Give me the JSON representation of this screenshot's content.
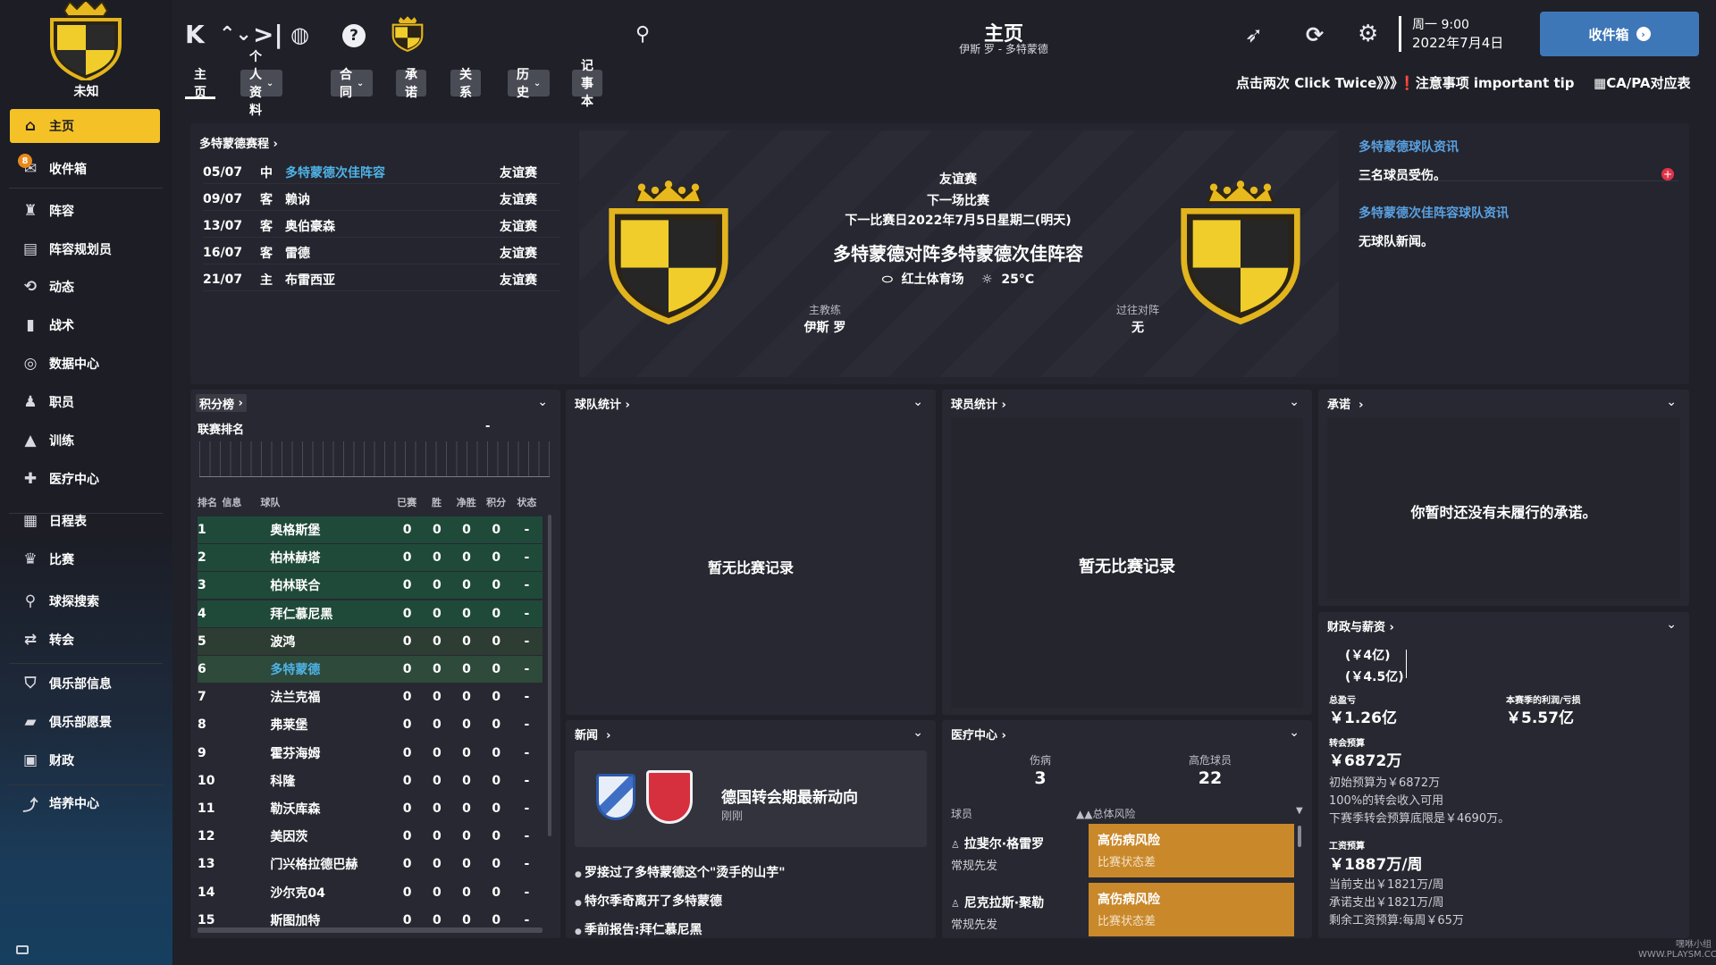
{
  "club": {
    "name": "未知"
  },
  "sidebar": {
    "items": [
      {
        "label": "主页",
        "icon": "home-icon"
      },
      {
        "label": "收件箱",
        "icon": "inbox-icon",
        "badge": "8"
      },
      {
        "label": "阵容",
        "icon": "shirt-icon"
      },
      {
        "label": "阵容规划员",
        "icon": "clipboard-icon"
      },
      {
        "label": "动态",
        "icon": "dynamics-icon"
      },
      {
        "label": "战术",
        "icon": "tactics-icon"
      },
      {
        "label": "数据中心",
        "icon": "data-icon"
      },
      {
        "label": "职员",
        "icon": "staff-icon"
      },
      {
        "label": "训练",
        "icon": "training-icon"
      },
      {
        "label": "医疗中心",
        "icon": "medical-icon"
      },
      {
        "label": "日程表",
        "icon": "calendar-icon"
      },
      {
        "label": "比赛",
        "icon": "trophy-icon"
      },
      {
        "label": "球探搜索",
        "icon": "search-icon"
      },
      {
        "label": "转会",
        "icon": "transfer-icon"
      },
      {
        "label": "俱乐部信息",
        "icon": "shield-icon"
      },
      {
        "label": "俱乐部愿景",
        "icon": "vision-icon"
      },
      {
        "label": "财政",
        "icon": "finance-icon"
      },
      {
        "label": "培养中心",
        "icon": "development-icon"
      }
    ]
  },
  "header": {
    "title": "主页",
    "subtitle": "伊斯 罗 - 多特蒙德",
    "time": "周一 9:00",
    "date": "2022年7月4日",
    "inbox_button": "收件箱"
  },
  "tabs": [
    "主页",
    "个人资料",
    "合同",
    "承诺",
    "关系",
    "历史",
    "记事本"
  ],
  "tips": {
    "click_twice": "点击两次 Click Twice》》》",
    "important": "注意事项 important tip",
    "capa": "CA/PA对应表"
  },
  "fixtures": {
    "title": "多特蒙德赛程",
    "rows": [
      {
        "date": "05/07",
        "venue": "中",
        "opponent": "多特蒙德次佳阵容",
        "comp": "友谊赛",
        "highlight": true
      },
      {
        "date": "09/07",
        "venue": "客",
        "opponent": "赖讷",
        "comp": "友谊赛",
        "highlight": false
      },
      {
        "date": "13/07",
        "venue": "客",
        "opponent": "奥伯豪森",
        "comp": "友谊赛",
        "highlight": false
      },
      {
        "date": "16/07",
        "venue": "客",
        "opponent": "雷德",
        "comp": "友谊赛",
        "highlight": false
      },
      {
        "date": "21/07",
        "venue": "主",
        "opponent": "布雷西亚",
        "comp": "友谊赛",
        "highlight": false
      }
    ]
  },
  "next_match": {
    "comp": "友谊赛",
    "label": "下一场比赛",
    "when": "下一比赛日2022年7月5日星期二(明天)",
    "fixture": "多特蒙德对阵多特蒙德次佳阵容",
    "stadium": "红土体育场",
    "temp": "25°C",
    "coach_label": "主教练",
    "coach": "伊斯 罗",
    "past_label": "过往对阵",
    "past": "无"
  },
  "club_news": {
    "h1": "多特蒙德球队资讯",
    "t1": "三名球员受伤。",
    "h2": "多特蒙德次佳阵容球队资讯",
    "t2": "无球队新闻。"
  },
  "league": {
    "title": "积分榜",
    "sub": "联赛排名",
    "dash": "-",
    "headers": [
      "排名",
      "信息",
      "球队",
      "已赛",
      "胜",
      "净胜",
      "积分",
      "状态"
    ],
    "rows": [
      {
        "pos": "1",
        "team": "奥格斯堡",
        "p": "0",
        "w": "0",
        "gd": "0",
        "pts": "0",
        "st": "-",
        "zone": "cl"
      },
      {
        "pos": "2",
        "team": "柏林赫塔",
        "p": "0",
        "w": "0",
        "gd": "0",
        "pts": "0",
        "st": "-",
        "zone": "cl"
      },
      {
        "pos": "3",
        "team": "柏林联合",
        "p": "0",
        "w": "0",
        "gd": "0",
        "pts": "0",
        "st": "-",
        "zone": "cl"
      },
      {
        "pos": "4",
        "team": "拜仁慕尼黑",
        "p": "0",
        "w": "0",
        "gd": "0",
        "pts": "0",
        "st": "-",
        "zone": "cl"
      },
      {
        "pos": "5",
        "team": "波鸿",
        "p": "0",
        "w": "0",
        "gd": "0",
        "pts": "0",
        "st": "-",
        "zone": "el"
      },
      {
        "pos": "6",
        "team": "多特蒙德",
        "p": "0",
        "w": "0",
        "gd": "0",
        "pts": "0",
        "st": "-",
        "zone": "own"
      },
      {
        "pos": "7",
        "team": "法兰克福",
        "p": "0",
        "w": "0",
        "gd": "0",
        "pts": "0",
        "st": "-",
        "zone": ""
      },
      {
        "pos": "8",
        "team": "弗莱堡",
        "p": "0",
        "w": "0",
        "gd": "0",
        "pts": "0",
        "st": "-",
        "zone": ""
      },
      {
        "pos": "9",
        "team": "霍芬海姆",
        "p": "0",
        "w": "0",
        "gd": "0",
        "pts": "0",
        "st": "-",
        "zone": ""
      },
      {
        "pos": "10",
        "team": "科隆",
        "p": "0",
        "w": "0",
        "gd": "0",
        "pts": "0",
        "st": "-",
        "zone": ""
      },
      {
        "pos": "11",
        "team": "勒沃库森",
        "p": "0",
        "w": "0",
        "gd": "0",
        "pts": "0",
        "st": "-",
        "zone": ""
      },
      {
        "pos": "12",
        "team": "美因茨",
        "p": "0",
        "w": "0",
        "gd": "0",
        "pts": "0",
        "st": "-",
        "zone": ""
      },
      {
        "pos": "13",
        "team": "门兴格拉德巴赫",
        "p": "0",
        "w": "0",
        "gd": "0",
        "pts": "0",
        "st": "-",
        "zone": ""
      },
      {
        "pos": "14",
        "team": "沙尔克04",
        "p": "0",
        "w": "0",
        "gd": "0",
        "pts": "0",
        "st": "-",
        "zone": ""
      },
      {
        "pos": "15",
        "team": "斯图加特",
        "p": "0",
        "w": "0",
        "gd": "0",
        "pts": "0",
        "st": "-",
        "zone": ""
      }
    ]
  },
  "team_stats": {
    "title": "球队统计",
    "empty": "暂无比赛记录"
  },
  "player_stats": {
    "title": "球员统计",
    "empty": "暂无比赛记录"
  },
  "promises": {
    "title": "承诺",
    "empty": "你暂时还没有未履行的承诺。"
  },
  "news": {
    "title": "新闻",
    "headline": "德国转会期最新动向",
    "time": "刚刚",
    "items": [
      "罗接过了多特蒙德这个\"烫手的山芋\"",
      "特尔季奇离开了多特蒙德",
      "季前报告:拜仁慕尼黑"
    ]
  },
  "medical": {
    "title": "医疗中心",
    "injured_label": "伤病",
    "injured": "3",
    "risk_label": "高危球员",
    "risk": "22",
    "col_player": "球员",
    "col_risk": "总体风险",
    "players": [
      {
        "name": "拉斐尔·格雷罗",
        "role": "常规先发",
        "risk": "高伤病风险",
        "risk_sub": "比赛状态差"
      },
      {
        "name": "尼克拉斯·聚勒",
        "role": "常规先发",
        "risk": "高伤病风险",
        "risk_sub": "比赛状态差"
      }
    ]
  },
  "finance": {
    "title": "财政与薪资",
    "v1": "(￥4亿)",
    "v2": "(￥4.5亿)",
    "profit_label": "总盈亏",
    "profit": "￥1.26亿",
    "season_label": "本赛季的利润/亏损",
    "season": "￥5.57亿",
    "transfer_label": "转会预算",
    "transfer": "￥6872万",
    "transfer_l1": "初始预算为￥6872万",
    "transfer_l2": "100%的转会收入可用",
    "transfer_l3": "下赛季转会预算底限是￥4690万。",
    "wage_label": "工资预算",
    "wage": "￥1887万/周",
    "wage_l1": "当前支出￥1821万/周",
    "wage_l2": "承诺支出￥1821万/周",
    "wage_l3": "剩余工资预算:每周￥65万"
  },
  "watermark": "嘿咻小组 WWW.PLAYSM.CC",
  "colors": {
    "accent": "#f4c226",
    "link": "#4fb3e8",
    "blue_btn": "#3e77b8",
    "risk": "#c9882a"
  }
}
